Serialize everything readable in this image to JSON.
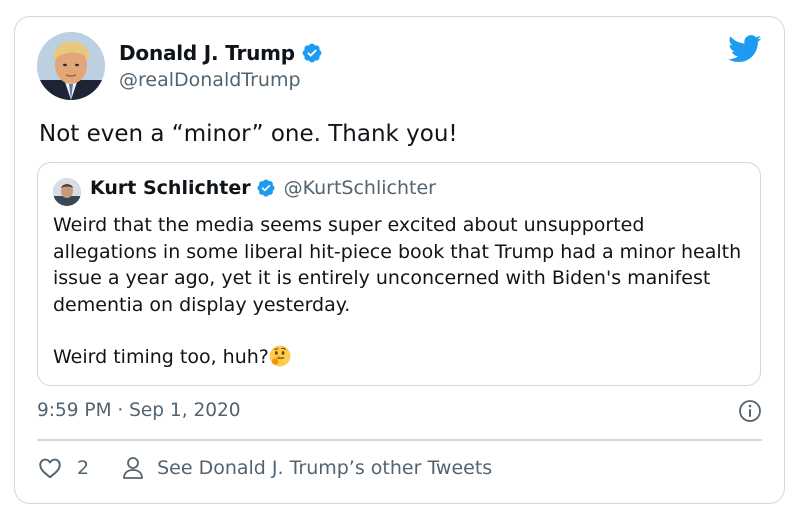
{
  "author": {
    "name": "Donald J. Trump",
    "handle": "@realDonaldTrump",
    "avatar": "portrait-avatar",
    "verified_color": "#1d9bf0"
  },
  "tweet": {
    "text": "Not even a “minor” one. Thank you!"
  },
  "quoted": {
    "name": "Kurt Schlichter",
    "handle": "@KurtSchlichter",
    "paragraph1": "Weird that the media seems super excited about unsupported allegations in some liberal hit-piece book that Trump had a minor health issue a year ago, yet it is entirely unconcerned with Biden's manifest dementia on display yesterday.",
    "paragraph2": "Weird timing too, huh?",
    "emoji": "thinking-face"
  },
  "meta": {
    "timestamp": "9:59 PM · Sep 1, 2020"
  },
  "actions": {
    "like_count": "2",
    "see_other_label": "See Donald J. Trump’s other Tweets"
  },
  "icons": {
    "brand": "twitter-bird-icon",
    "info": "info-icon",
    "like": "heart-icon",
    "profile": "person-icon"
  },
  "colors": {
    "brand": "#1d9bf0",
    "text": "#0f1419",
    "secondary": "#536471",
    "border": "#cfd9de"
  }
}
